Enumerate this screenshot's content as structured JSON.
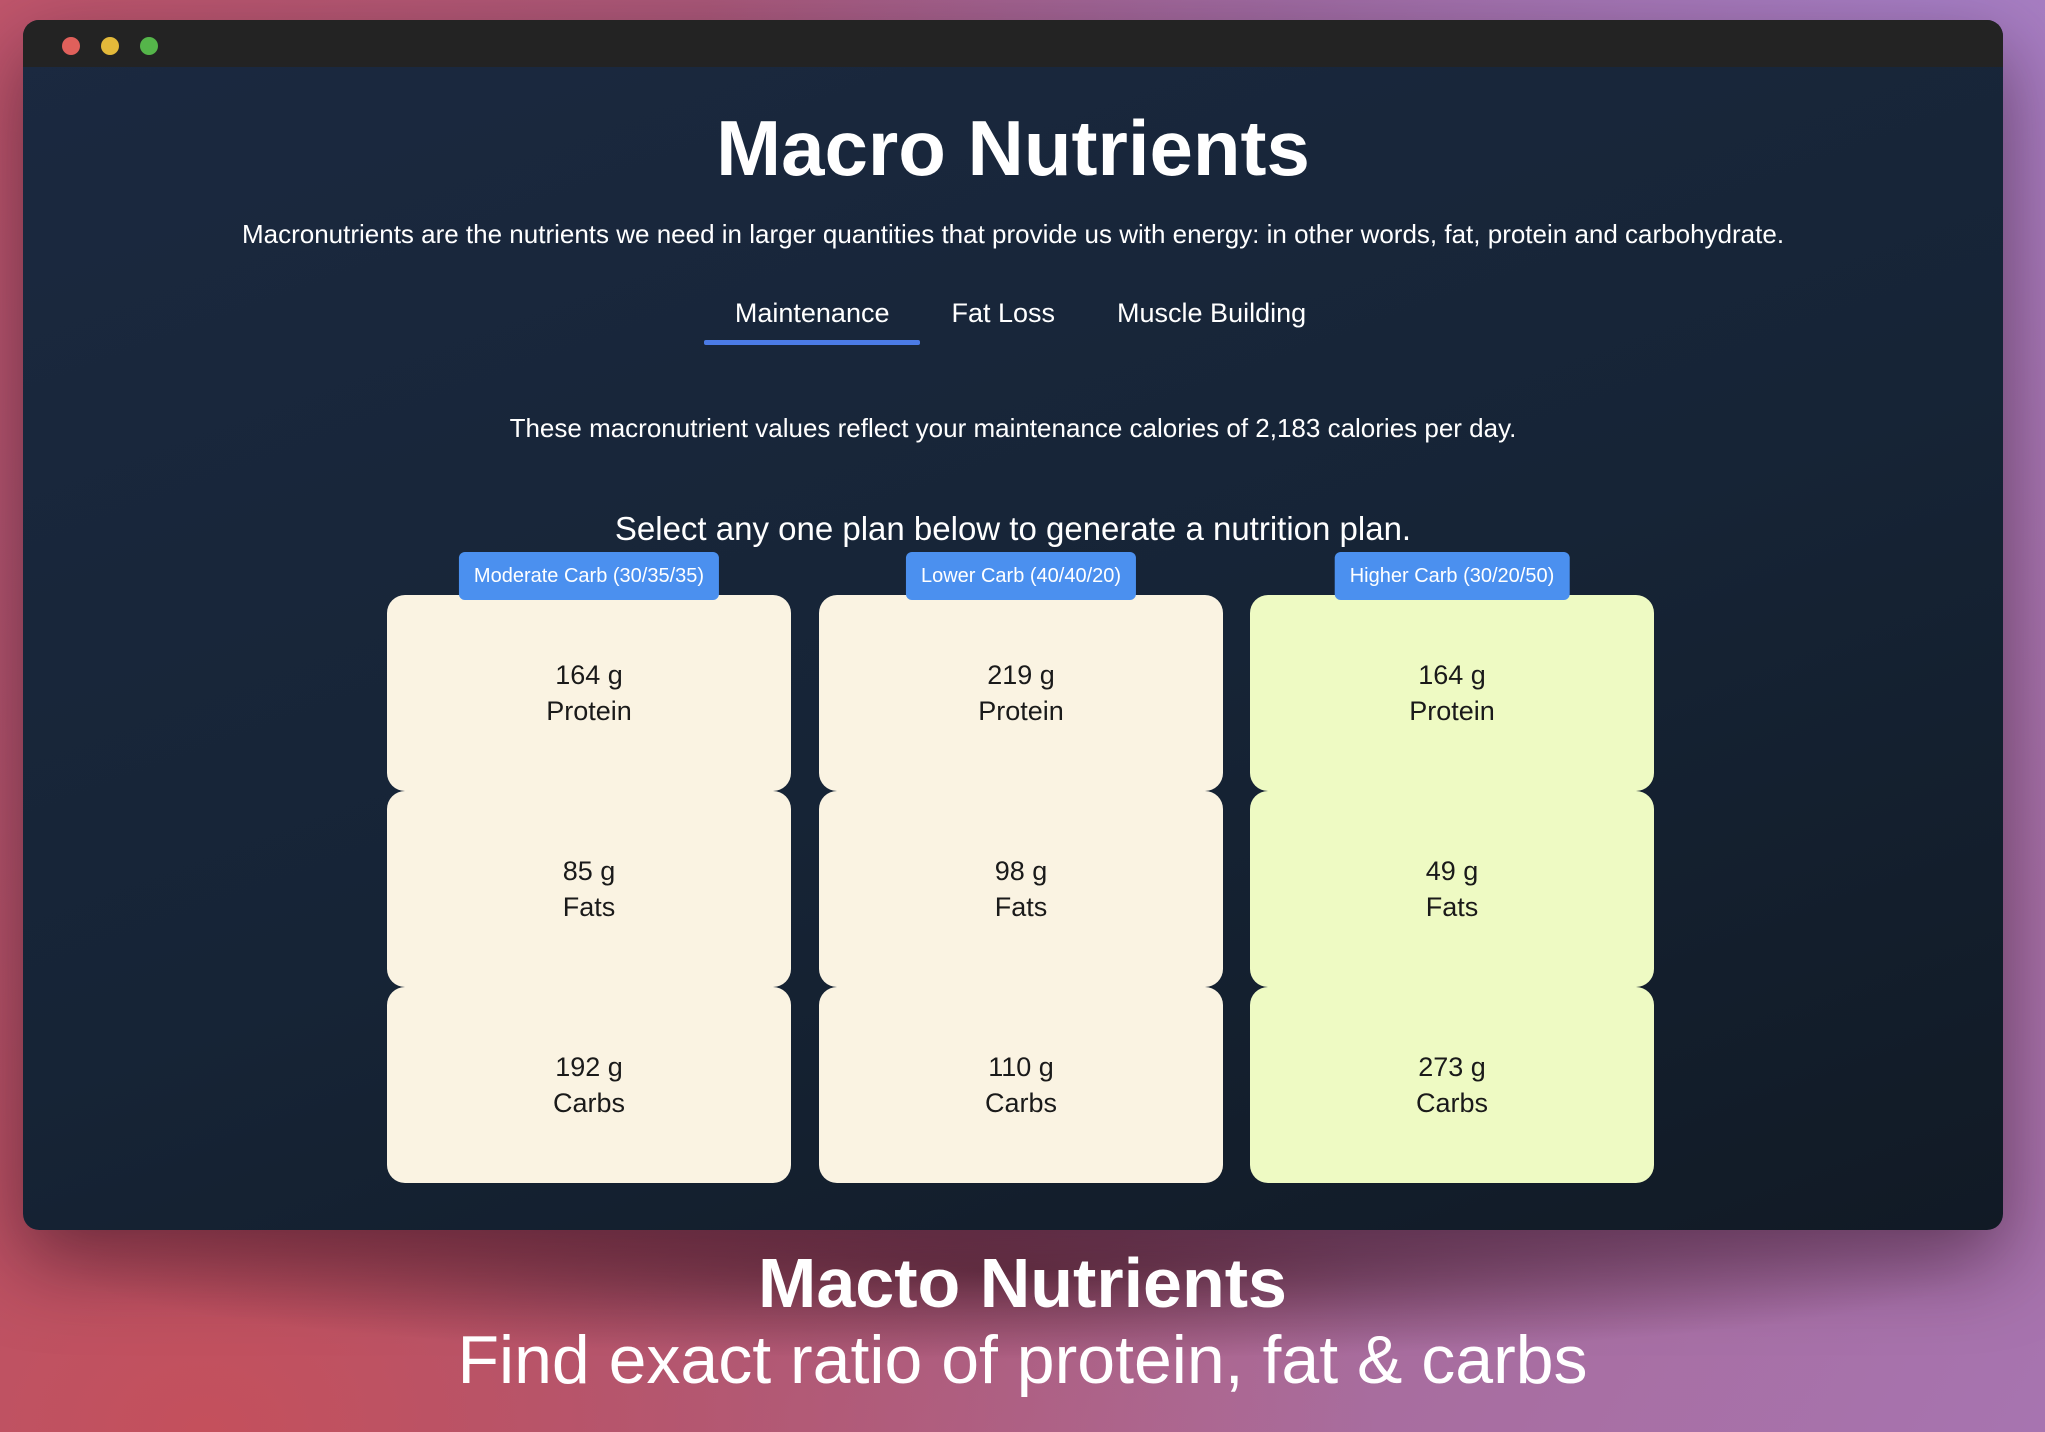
{
  "window": {
    "controls": [
      "close",
      "minimize",
      "zoom"
    ]
  },
  "header": {
    "title": "Macro Nutrients",
    "intro": "Macronutrients are the nutrients we need in larger quantities that provide us with energy: in other words, fat, protein and carbohydrate."
  },
  "tabs": [
    {
      "label": "Maintenance",
      "active": true
    },
    {
      "label": "Fat Loss",
      "active": false
    },
    {
      "label": "Muscle Building",
      "active": false
    }
  ],
  "maintenance_text": "These macronutrient values reflect your maintenance calories of 2,183 calories per day.",
  "select_prompt": "Select any one plan below to generate a nutrition plan.",
  "plans": [
    {
      "label": "Moderate Carb (30/35/35)",
      "theme": "cream",
      "protein_value": "164 g",
      "protein_label": "Protein",
      "fats_value": "85 g",
      "fats_label": "Fats",
      "carbs_value": "192 g",
      "carbs_label": "Carbs"
    },
    {
      "label": "Lower Carb (40/40/20)",
      "theme": "cream",
      "protein_value": "219 g",
      "protein_label": "Protein",
      "fats_value": "98 g",
      "fats_label": "Fats",
      "carbs_value": "110 g",
      "carbs_label": "Carbs"
    },
    {
      "label": "Higher Carb (30/20/50)",
      "theme": "lime",
      "protein_value": "164 g",
      "protein_label": "Protein",
      "fats_value": "49 g",
      "fats_label": "Fats",
      "carbs_value": "273 g",
      "carbs_label": "Carbs"
    }
  ],
  "caption": {
    "title": "Macto Nutrients",
    "subtitle": "Find exact ratio of protein, fat & carbs"
  },
  "colors": {
    "accent": "#4b7be6",
    "badge": "#4b90ef",
    "cream_card": "#faf3e2",
    "lime_card": "#eefac3",
    "window_bg": "#162436"
  }
}
